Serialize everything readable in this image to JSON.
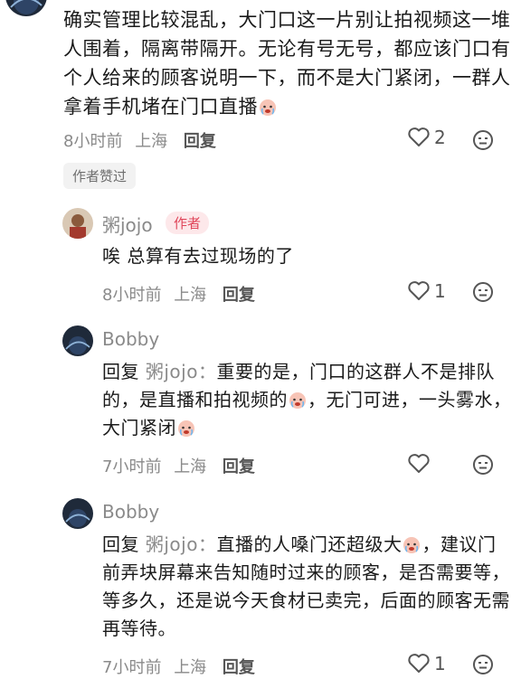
{
  "top_comment": {
    "text": "确实管理比较混乱，大门口这一片别让拍视频这一堆人围着，隔离带隔开。无论有号无号，都应该门口有个人给来的顾客说明一下，而不是大门紧闭，一群人拿着手机堵在门口直播",
    "time": "8小时前",
    "location": "上海",
    "reply_label": "回复",
    "likes": "2",
    "author_liked_badge": "作者赞过"
  },
  "replies": [
    {
      "user": "粥jojo",
      "tag": "作者",
      "text": "唉 总算有去过现场的了",
      "time": "8小时前",
      "location": "上海",
      "reply_label": "回复",
      "likes": "1"
    },
    {
      "user": "Bobby",
      "reply_prefix": "回复",
      "mention": "粥jojo：",
      "text_part1": "重要的是，门口的这群人不是排队的，是直播和拍视频的",
      "text_part2": "，无门可进，一头雾水，大门紧闭",
      "time": "7小时前",
      "location": "上海",
      "reply_label": "回复",
      "likes": ""
    },
    {
      "user": "Bobby",
      "reply_prefix": "回复",
      "mention": "粥jojo：",
      "text_part1": "直播的人嗓门还超级大",
      "text_part2": "，建议门前弄块屏幕来告知随时过来的顾客，是否需要等，等多久，还是说今天食材已卖完，后面的顾客无需再等待。",
      "time": "7小时前",
      "location": "上海",
      "reply_label": "回复",
      "likes": "1"
    }
  ],
  "icons": {
    "like": "heart-outline-icon",
    "dislike": "meh-face-icon",
    "emoji": "crying-emoji-icon"
  }
}
